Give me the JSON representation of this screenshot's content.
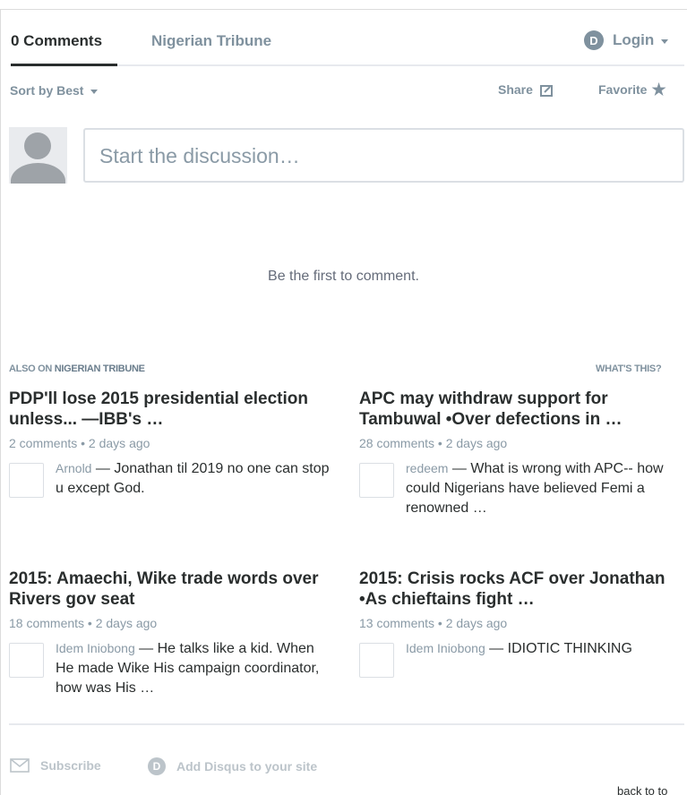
{
  "nav": {
    "comments_tab": "0 Comments",
    "forum_tab": "Nigerian Tribune",
    "login_label": "Login",
    "login_logo": "D"
  },
  "toolbar": {
    "sort_label": "Sort by Best",
    "share_label": "Share",
    "favorite_label": "Favorite"
  },
  "composer": {
    "placeholder": "Start the discussion…"
  },
  "empty_state": "Be the first to comment.",
  "also_on": {
    "prefix": "ALSO ON",
    "forum": "NIGERIAN TRIBUNE",
    "whats_this": "WHAT'S THIS?"
  },
  "cards": [
    {
      "title": "PDP'll lose 2015 presidential election unless... —IBB's …",
      "meta": "2 comments • 2 days ago",
      "author": "Arnold",
      "text": " — Jonathan til 2019 no one can stop u except God."
    },
    {
      "title": "APC may withdraw support for Tambuwal •Over defections in …",
      "meta": "28 comments • 2 days ago",
      "author": "redeem",
      "text": " — What is wrong with APC-- how could Nigerians have believed Femi a renowned …"
    },
    {
      "title": "2015: Amaechi, Wike trade words over Rivers gov seat",
      "meta": "18 comments • 2 days ago",
      "author": "Idem Iniobong",
      "text": " — He talks like a kid. When He made Wike His campaign coordinator, how was His …"
    },
    {
      "title": "2015: Crisis rocks ACF over Jonathan •As chieftains fight …",
      "meta": "13 comments • 2 days ago",
      "author": "Idem Iniobong",
      "text": " — IDIOTIC THINKING"
    }
  ],
  "footer": {
    "subscribe_label": "Subscribe",
    "add_disqus_label": "Add Disqus to your site",
    "add_disqus_logo": "D",
    "back_to_top": "back to to"
  }
}
